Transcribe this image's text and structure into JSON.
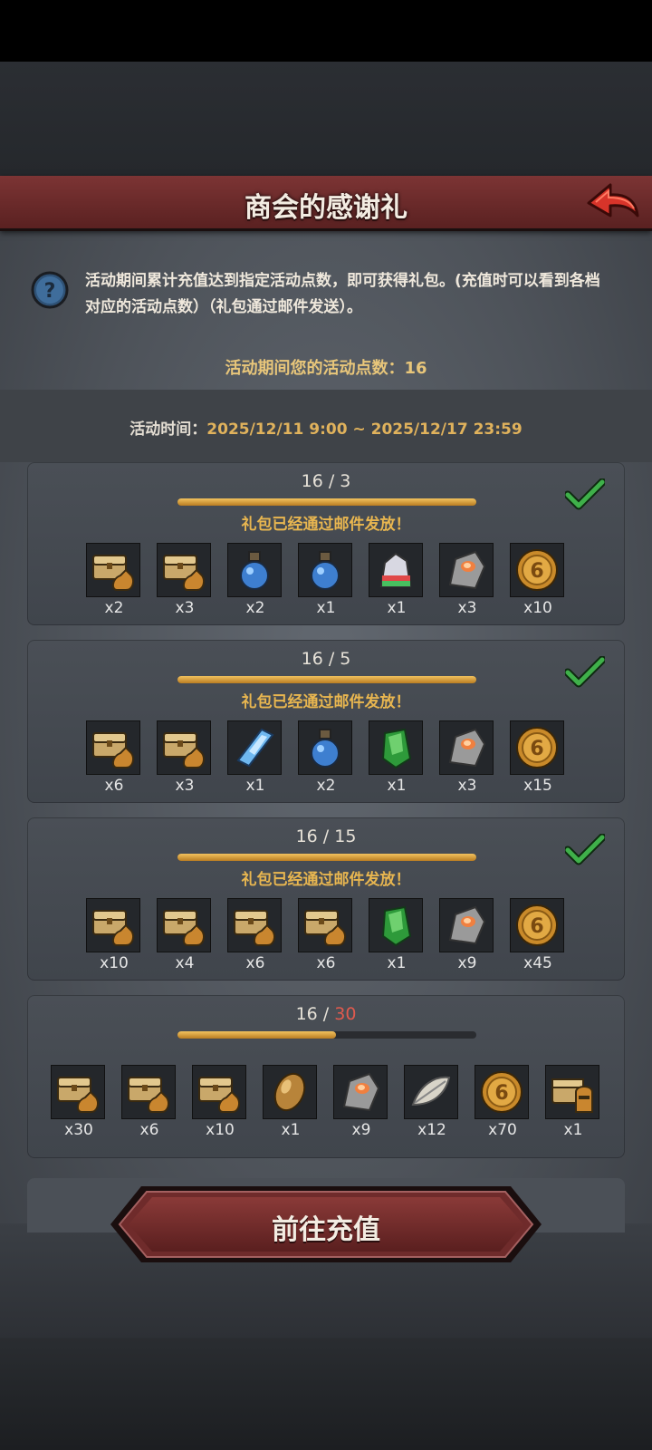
{
  "title": "商会的感谢礼",
  "notice": "活动期间累计充值达到指定活动点数，即可获得礼包。(充值时可以看到各档对应的活动点数）（礼包通过邮件发送）。",
  "points": {
    "label": "活动期间您的活动点数：",
    "value": "16"
  },
  "time": {
    "label": "活动时间：",
    "value": "2025/12/11 9:00 ~ 2025/12/17 23:59"
  },
  "colors": {
    "accent_gold": "#e8b650",
    "title_red": "#7c3434",
    "check_green": "#3fb04a",
    "need_red": "#e05a4e"
  },
  "tiers": [
    {
      "current": "16",
      "sep": " / ",
      "required": "3",
      "progress": 1.0,
      "claimed": true,
      "status": "礼包已经通过邮件发放！",
      "items": [
        {
          "icon": "chest-bag-icon",
          "qty": "x2"
        },
        {
          "icon": "chest-bag-icon",
          "qty": "x3"
        },
        {
          "icon": "blue-potion-icon",
          "qty": "x2"
        },
        {
          "icon": "blue-potion-icon",
          "qty": "x1"
        },
        {
          "icon": "rainbow-crystal-icon",
          "qty": "x1"
        },
        {
          "icon": "ore-stone-icon",
          "qty": "x3"
        },
        {
          "icon": "gold-coin-icon",
          "qty": "x10"
        }
      ]
    },
    {
      "current": "16",
      "sep": " / ",
      "required": "5",
      "progress": 1.0,
      "claimed": true,
      "status": "礼包已经通过邮件发放！",
      "items": [
        {
          "icon": "chest-bag-icon",
          "qty": "x6"
        },
        {
          "icon": "chest-bag-icon",
          "qty": "x3"
        },
        {
          "icon": "blue-crystal-icon",
          "qty": "x1"
        },
        {
          "icon": "blue-potion-icon",
          "qty": "x2"
        },
        {
          "icon": "green-gem-icon",
          "qty": "x1"
        },
        {
          "icon": "ore-stone-icon",
          "qty": "x3"
        },
        {
          "icon": "gold-coin-icon",
          "qty": "x15"
        }
      ]
    },
    {
      "current": "16",
      "sep": " / ",
      "required": "15",
      "progress": 1.0,
      "claimed": true,
      "status": "礼包已经通过邮件发放！",
      "items": [
        {
          "icon": "chest-bag-icon",
          "qty": "x10"
        },
        {
          "icon": "chest-bag-icon",
          "qty": "x4"
        },
        {
          "icon": "chest-bag-icon",
          "qty": "x6"
        },
        {
          "icon": "chest-bag-icon",
          "qty": "x6"
        },
        {
          "icon": "green-gem-icon",
          "qty": "x1"
        },
        {
          "icon": "ore-stone-icon",
          "qty": "x9"
        },
        {
          "icon": "gold-coin-icon",
          "qty": "x45"
        }
      ]
    },
    {
      "current": "16",
      "sep": " / ",
      "required": "30",
      "progress": 0.53,
      "claimed": false,
      "status": "",
      "items": [
        {
          "icon": "chest-bag-icon",
          "qty": "x30"
        },
        {
          "icon": "chest-bag-icon",
          "qty": "x6"
        },
        {
          "icon": "chest-bag-icon",
          "qty": "x10"
        },
        {
          "icon": "amber-egg-icon",
          "qty": "x1"
        },
        {
          "icon": "ore-stone-icon",
          "qty": "x9"
        },
        {
          "icon": "feather-icon",
          "qty": "x12"
        },
        {
          "icon": "gold-coin-icon",
          "qty": "x70"
        },
        {
          "icon": "helmet-chest-icon",
          "qty": "x1"
        }
      ]
    }
  ],
  "button": {
    "label": "前往充值"
  }
}
